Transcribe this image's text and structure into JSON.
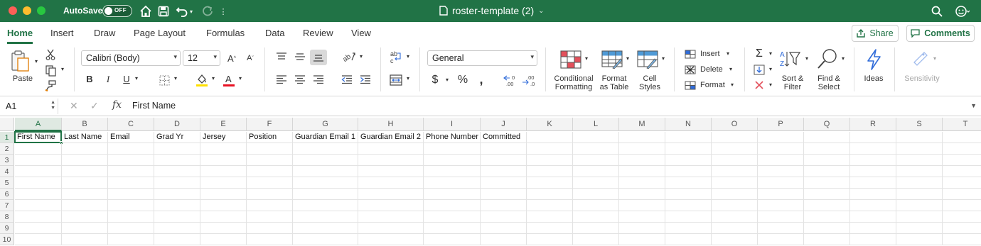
{
  "titlebar": {
    "autosave_label": "AutoSave",
    "autosave_state": "OFF",
    "document_title": "roster-template (2)"
  },
  "tabs": [
    "Home",
    "Insert",
    "Draw",
    "Page Layout",
    "Formulas",
    "Data",
    "Review",
    "View"
  ],
  "actions": {
    "share": "Share",
    "comments": "Comments"
  },
  "ribbon": {
    "paste": "Paste",
    "font_name": "Calibri (Body)",
    "font_size": "12",
    "number_format": "General",
    "conditional_formatting": [
      "Conditional",
      "Formatting"
    ],
    "format_as_table": [
      "Format",
      "as Table"
    ],
    "cell_styles": [
      "Cell",
      "Styles"
    ],
    "insert": "Insert",
    "delete": "Delete",
    "format": "Format",
    "sort_filter": [
      "Sort &",
      "Filter"
    ],
    "find_select": [
      "Find &",
      "Select"
    ],
    "ideas": "Ideas",
    "sensitivity": "Sensitivity",
    "colors": {
      "accent": "#217346",
      "highlight": "#ffe000",
      "font_color": "#e81123",
      "ideas_blue": "#2f6bd9"
    }
  },
  "formula_bar": {
    "name_box": "A1",
    "fx": "fx",
    "content": "First Name"
  },
  "sheet": {
    "columns": [
      "A",
      "B",
      "C",
      "D",
      "E",
      "F",
      "G",
      "H",
      "I",
      "J",
      "K",
      "L",
      "M",
      "N",
      "O",
      "P",
      "Q",
      "R",
      "S",
      "T"
    ],
    "rows": [
      "1",
      "2",
      "3",
      "4",
      "5",
      "6",
      "7",
      "8",
      "9",
      "10"
    ],
    "row1": [
      "First Name",
      "Last Name",
      "Email",
      "Grad Yr",
      "Jersey",
      "Position",
      "Guardian Email 1",
      "Guardian Email 2",
      "Phone Number",
      "Committed"
    ]
  }
}
